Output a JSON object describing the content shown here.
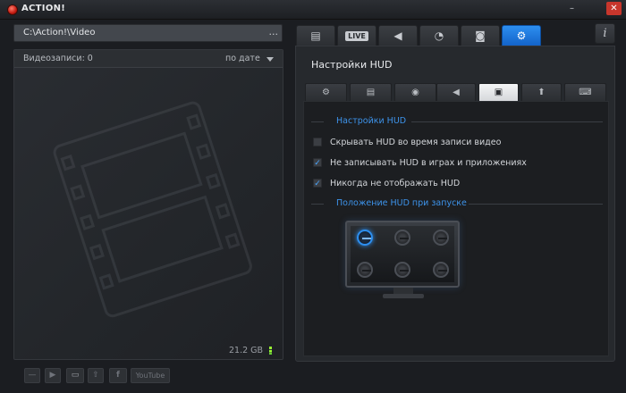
{
  "window": {
    "title": "ACTION!",
    "minimize": "–",
    "close": "✕"
  },
  "left": {
    "path": "C:\\Action!\\Video",
    "path_button": "...",
    "recordings_label": "Видеозаписи: 0",
    "sort_label": "по дате",
    "disk_size": "21.2 GB"
  },
  "toolbar": {
    "delete": "—",
    "play": "▶",
    "folder": "▭",
    "upload": "⇧",
    "facebook": "f",
    "youtube": "YouTube"
  },
  "tabs": [
    {
      "name": "video-tab",
      "icon": "film-icon",
      "glyph": "▤"
    },
    {
      "name": "live-tab",
      "icon": "live-icon",
      "label": "LIVE"
    },
    {
      "name": "audio-tab",
      "icon": "speaker-icon",
      "glyph": "◀"
    },
    {
      "name": "benchmark-tab",
      "icon": "stopwatch-icon",
      "glyph": "◔"
    },
    {
      "name": "screenshot-tab",
      "icon": "camera-icon",
      "glyph": "◙"
    },
    {
      "name": "settings-tab",
      "icon": "gear-icon",
      "glyph": "⚙"
    }
  ],
  "info_button": "i",
  "panel": {
    "title": "Настройки HUD",
    "subtabs": [
      {
        "name": "general",
        "icon": "gear-icon",
        "glyph": "⚙"
      },
      {
        "name": "video",
        "icon": "film-icon",
        "glyph": "▤"
      },
      {
        "name": "webcam",
        "icon": "webcam-icon",
        "glyph": "◉"
      },
      {
        "name": "audio",
        "icon": "speaker-icon",
        "glyph": "◀"
      },
      {
        "name": "hud",
        "icon": "monitor-icon",
        "glyph": "▣"
      },
      {
        "name": "upload",
        "icon": "upload-icon",
        "glyph": "⬆"
      },
      {
        "name": "hotkeys",
        "icon": "keyboard-icon",
        "glyph": "⌨"
      }
    ],
    "active_subtab": 4,
    "hud_section": "Настройки HUD",
    "options": [
      {
        "label": "Скрывать HUD во время записи видео",
        "checked": false,
        "mark": ""
      },
      {
        "label": "Не записывать HUD в играх и приложениях",
        "checked": true,
        "mark": "✓"
      },
      {
        "label": "Никогда не отображать HUD",
        "checked": true,
        "mark": "✓"
      }
    ],
    "position_section": "Положение HUD при запуске",
    "position_selected": "top-left"
  },
  "colors": {
    "accent": "#2d8ff0",
    "section_label": "#3d93ea",
    "close": "#c8362c"
  }
}
